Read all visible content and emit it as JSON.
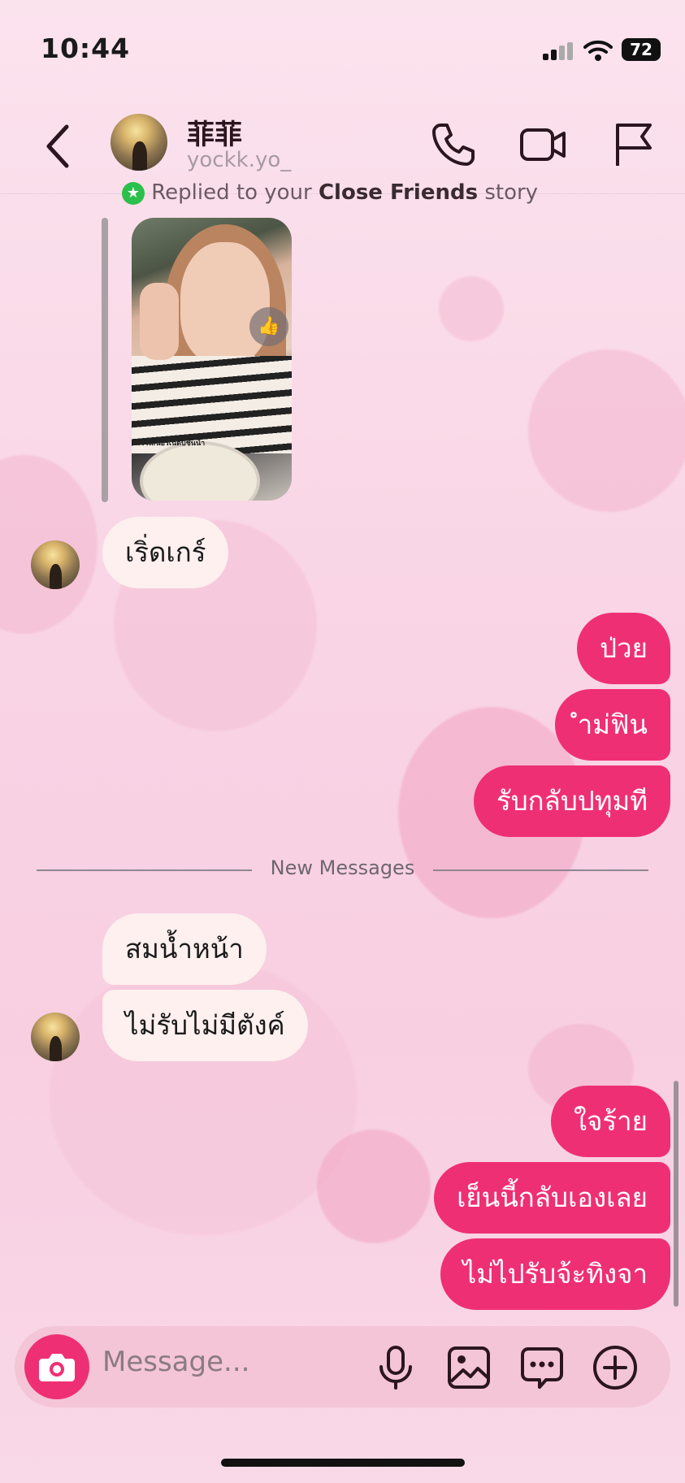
{
  "status": {
    "time": "10:44",
    "battery": "72"
  },
  "header": {
    "name": "菲菲",
    "handle": "yockk.yo_"
  },
  "story_reply": {
    "prefix": "Replied to your ",
    "highlight": "Close Friends",
    "suffix": " story",
    "caption": "รีวิวเสนอร์เน็ตบีชั้นนำ"
  },
  "messages": [
    {
      "text": "เริ่ดเกร์",
      "from": "them"
    },
    {
      "text": "ป่วย",
      "from": "me"
    },
    {
      "text": "ำม่ฟิน",
      "from": "me"
    },
    {
      "text": "รับกลับปทุมที",
      "from": "me"
    },
    {
      "text": "สมน้ำหน้า",
      "from": "them"
    },
    {
      "text": "ไม่รับไม่มีตังค์",
      "from": "them"
    },
    {
      "text": "ใจร้าย",
      "from": "me"
    },
    {
      "text": "เย็นนี้กลับเองเลย",
      "from": "me"
    },
    {
      "text": "ไม่ไปรับจ้ะทิงจา",
      "from": "me"
    }
  ],
  "divider": {
    "label": "New Messages"
  },
  "composer": {
    "placeholder": "Message..."
  },
  "colors": {
    "outgoing": "#ef2f74",
    "incoming": "#fdf0ef",
    "background": "#f9d5e5"
  }
}
